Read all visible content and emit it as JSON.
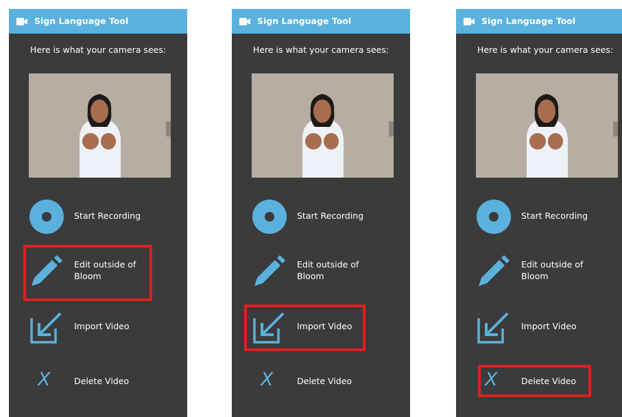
{
  "panels": [
    {
      "title": "Sign Language Tool",
      "caption": "Here is what your camera sees:",
      "buttons": {
        "record": "Start Recording",
        "edit_line1": "Edit outside of",
        "edit_line2": "Bloom",
        "import": "Import Video",
        "delete": "Delete Video"
      },
      "highlighted": "edit"
    },
    {
      "title": "Sign Language Tool",
      "caption": "Here is what your camera sees:",
      "buttons": {
        "record": "Start Recording",
        "edit_line1": "Edit outside of",
        "edit_line2": "Bloom",
        "import": "Import Video",
        "delete": "Delete Video"
      },
      "highlighted": "import"
    },
    {
      "title": "Sign Language Tool",
      "caption": "Here is what your camera sees:",
      "buttons": {
        "record": "Start Recording",
        "edit_line1": "Edit outside of",
        "edit_line2": "Bloom",
        "import": "Import Video",
        "delete": "Delete Video"
      },
      "highlighted": "delete"
    }
  ],
  "colors": {
    "panel_bg": "#3b3b3b",
    "titlebar": "#5bb1dd",
    "accent_icon": "#5bb1dd",
    "highlight": "#e0201e"
  },
  "icons": {
    "title": "video-camera-icon",
    "record": "record-icon",
    "edit": "pencil-icon",
    "import": "import-arrow-icon",
    "delete": "x-icon"
  }
}
